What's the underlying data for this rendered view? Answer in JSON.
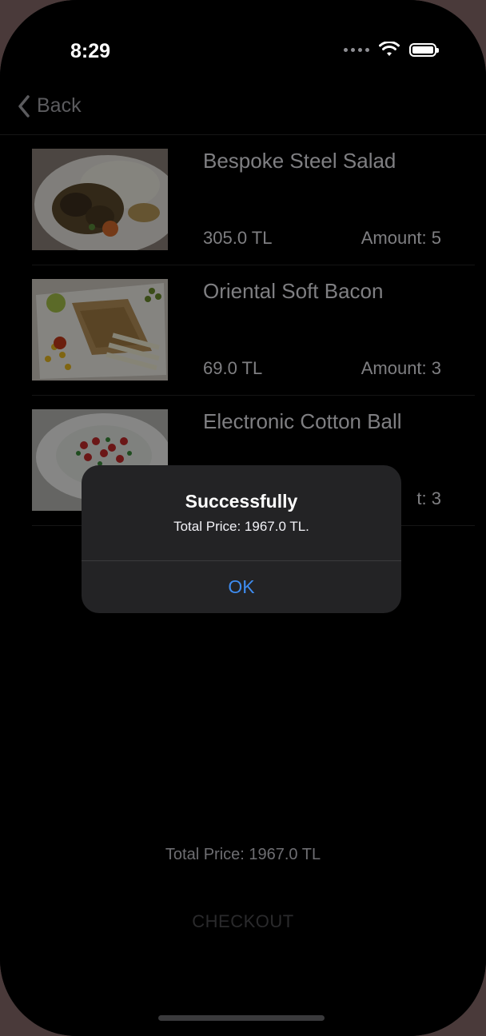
{
  "status_bar": {
    "time": "8:29"
  },
  "nav": {
    "back_label": "Back"
  },
  "cart_items": [
    {
      "name": "Bespoke Steel Salad",
      "price": "305.0 TL",
      "amount": "Amount: 5",
      "image": "food-photo-salad"
    },
    {
      "name": "Oriental Soft Bacon",
      "price": "69.0 TL",
      "amount": "Amount: 3",
      "image": "food-photo-bacon"
    },
    {
      "name": "Electronic Cotton Ball",
      "price": "",
      "amount": "t: 3",
      "image": "food-photo-ball"
    }
  ],
  "footer": {
    "total_price": "Total Price: 1967.0 TL",
    "checkout_label": "CHECKOUT"
  },
  "alert": {
    "title": "Successfully",
    "message": "Total Price: 1967.0 TL.",
    "ok_label": "OK"
  },
  "colors": {
    "background": "#000000",
    "alert_background": "#232325",
    "accent_blue": "#3e8cf0",
    "dimmed_text": "#7f7f82"
  }
}
